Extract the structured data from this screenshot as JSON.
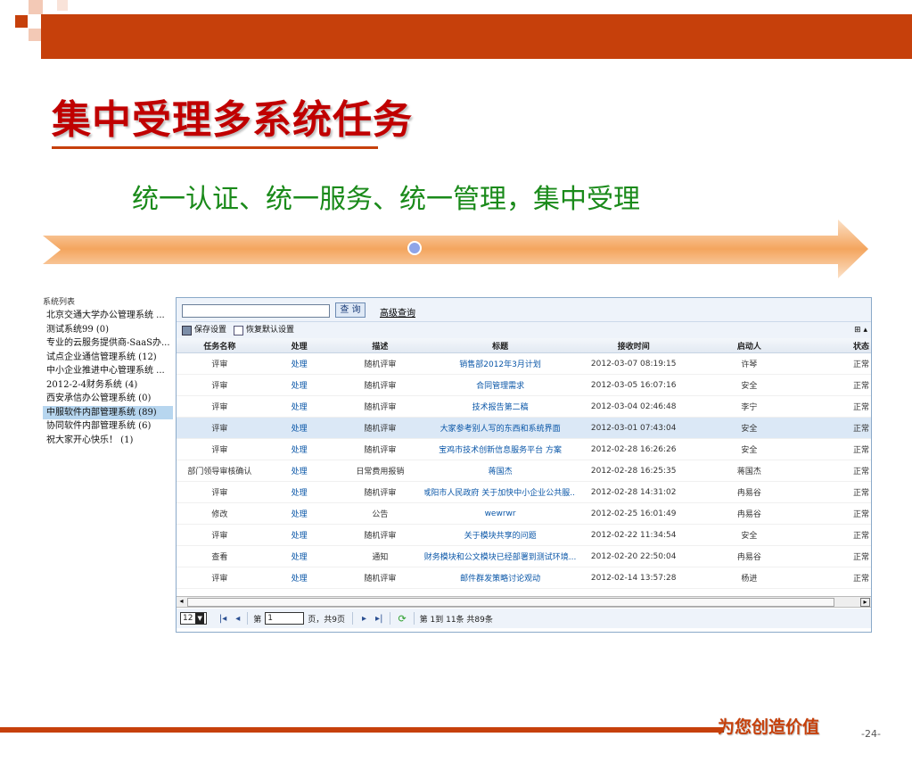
{
  "slide": {
    "title": "集中受理多系统任务",
    "subtitle": "统一认证、统一服务、统一管理，集中受理",
    "footer_slogan": "为您创造价值",
    "page_number": "-24-"
  },
  "colors": {
    "accent": "#c6400b",
    "title": "#c00000",
    "subtitle": "#1a8a1a",
    "selected_row": "#dbe8f6"
  },
  "sidebar": {
    "header": "系统列表",
    "items": [
      {
        "label": "北京交通大学办公管理系统 ..."
      },
      {
        "label": "测试系统99 (0)"
      },
      {
        "label": "专业的云服务提供商-SaaS办..."
      },
      {
        "label": "试点企业通信管理系统  (12)"
      },
      {
        "label": "中小企业推进中心管理系统 ..."
      },
      {
        "label": "2012-2-4财务系统  (4)"
      },
      {
        "label": "西安承信办公管理系统  (0)"
      },
      {
        "label": "中服软件内部管理系统  (89)"
      },
      {
        "label": "协同软件内部管理系统  (6)"
      },
      {
        "label": "祝大家开心快乐！ (1)"
      }
    ]
  },
  "search": {
    "button": "查 询",
    "advanced": "高级查询"
  },
  "toolbar": {
    "save": "保存设置",
    "restore": "恢复默认设置",
    "right": "⊞ ▴"
  },
  "table": {
    "columns": [
      "任务名称",
      "处理",
      "描述",
      "标题",
      "接收时间",
      "启动人",
      "状态"
    ],
    "rows": [
      [
        "评审",
        "处理",
        "随机评审",
        "销售部2012年3月计划",
        "2012-03-07 08:19:15",
        "许琴",
        "正常"
      ],
      [
        "评审",
        "处理",
        "随机评审",
        "合同管理需求",
        "2012-03-05 16:07:16",
        "安全",
        "正常"
      ],
      [
        "评审",
        "处理",
        "随机评审",
        "技术报告第二稿",
        "2012-03-04 02:46:48",
        "李宁",
        "正常"
      ],
      [
        "评审",
        "处理",
        "随机评审",
        "大家参考别人写的东西和系统界面",
        "2012-03-01 07:43:04",
        "安全",
        "正常"
      ],
      [
        "评审",
        "处理",
        "随机评审",
        "宝鸡市技术创新信息服务平台 方案",
        "2012-02-28 16:26:26",
        "安全",
        "正常"
      ],
      [
        "部门领导审核确认",
        "处理",
        "日常费用报销",
        "蒋国杰",
        "2012-02-28 16:25:35",
        "蒋国杰",
        "正常"
      ],
      [
        "评审",
        "处理",
        "随机评审",
        "咸阳市人民政府 关于加快中小企业公共服...",
        "2012-02-28 14:31:02",
        "冉易谷",
        "正常"
      ],
      [
        "修改",
        "处理",
        "公告",
        "wewrwr",
        "2012-02-25 16:01:49",
        "冉易谷",
        "正常"
      ],
      [
        "评审",
        "处理",
        "随机评审",
        "关于模块共享的问题",
        "2012-02-22 11:34:54",
        "安全",
        "正常"
      ],
      [
        "查看",
        "处理",
        "通知",
        "财务模块和公文模块已经部署到测试环境...",
        "2012-02-20 22:50:04",
        "冉易谷",
        "正常"
      ],
      [
        "评审",
        "处理",
        "随机评审",
        "邮件群发策略讨论观动",
        "2012-02-14 13:57:28",
        "杨进",
        "正常"
      ]
    ],
    "selected_row": 3
  },
  "pager": {
    "page_size": "12",
    "page_prefix": "第",
    "page_value": "1",
    "page_suffix": "页，共9页",
    "status": "第 1到 11条 共89条"
  }
}
